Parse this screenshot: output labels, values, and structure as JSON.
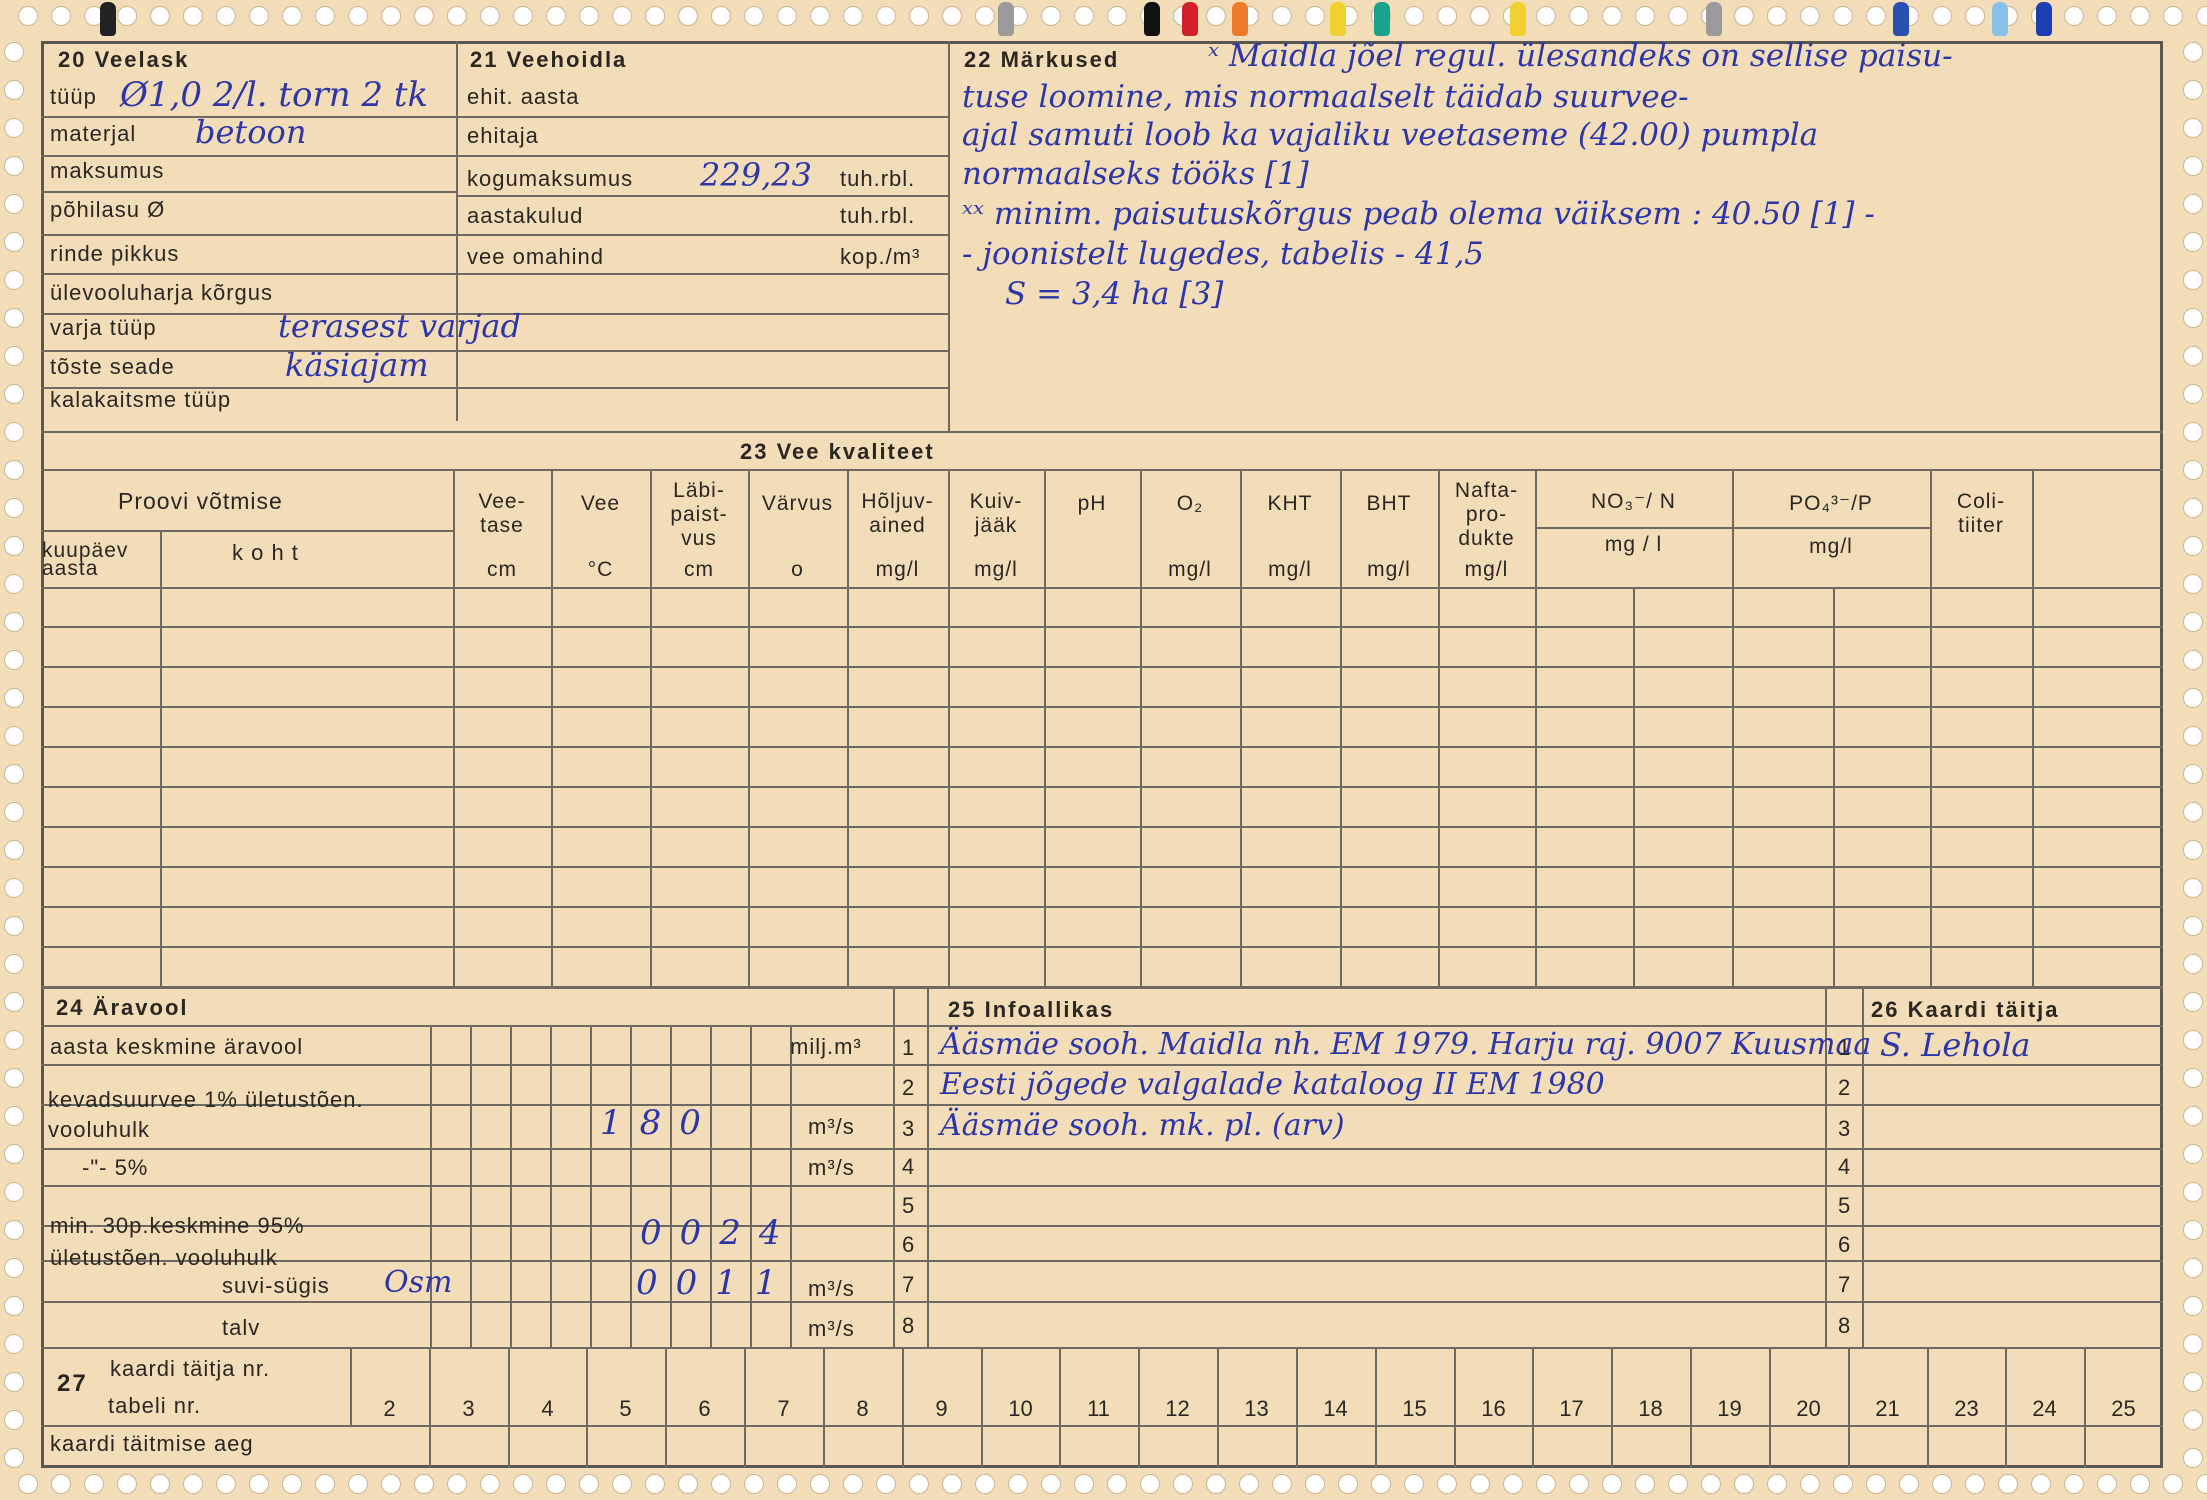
{
  "section20": {
    "title": "20 Veelask",
    "rows": [
      {
        "label": "tüüp",
        "value": "Ø1,0 2/l. torn 2 tk"
      },
      {
        "label": "materjal",
        "value": "betoon"
      },
      {
        "label": "maksumus",
        "value": ""
      },
      {
        "label": "põhilasu Ø",
        "value": ""
      },
      {
        "label": "rinde pikkus",
        "value": ""
      },
      {
        "label": "ülevooluharja kõrgus",
        "value": ""
      },
      {
        "label": "varja tüüp",
        "value": "terasest varjad"
      },
      {
        "label": "tõste seade",
        "value": "käsiajam"
      },
      {
        "label": "kalakaitsme tüüp",
        "value": ""
      }
    ]
  },
  "section21": {
    "title": "21 Veehoidla",
    "rows": [
      {
        "label": "ehit. aasta",
        "unit": "",
        "value": ""
      },
      {
        "label": "ehitaja",
        "unit": "",
        "value": ""
      },
      {
        "label": "kogumaksumus",
        "unit": "tuh.rbl.",
        "value": "229,23"
      },
      {
        "label": "aastakulud",
        "unit": "tuh.rbl.",
        "value": ""
      },
      {
        "label": "vee omahind",
        "unit": "kop./m³",
        "value": ""
      }
    ]
  },
  "section22": {
    "title": "22 Märkused",
    "lines": [
      "ˣ Maidla jõel regul. ülesandeks on sellise paisu-",
      "tuse loomine, mis normaalselt täidab suurvee-",
      "ajal samuti loob ka vajaliku veetaseme (42.00) pumpla",
      "normaalseks tööks [1]",
      "ˣˣ minim. paisutuskõrgus peab olema väiksem : 40.50 [1] -",
      "- joonistelt lugedes, tabelis - 41,5",
      "S = 3,4 ha [3]"
    ]
  },
  "section23": {
    "title": "23 Vee kvaliteet",
    "proovi": "Proovi võtmise",
    "kuupaev": "kuupäev aasta",
    "koht": "k o h t",
    "columns": [
      {
        "name": "Vee- tase",
        "unit": "cm"
      },
      {
        "name": "Vee",
        "unit": "°C"
      },
      {
        "name": "Läbi- paist- vus",
        "unit": "cm"
      },
      {
        "name": "Värvus",
        "unit": "o"
      },
      {
        "name": "Hõljuv- ained",
        "unit": "mg/l"
      },
      {
        "name": "Kuiv- jääk",
        "unit": "mg/l"
      },
      {
        "name": "pH",
        "unit": ""
      },
      {
        "name": "O₂",
        "unit": "mg/l"
      },
      {
        "name": "KHT",
        "unit": "mg/l"
      },
      {
        "name": "BHT",
        "unit": "mg/l"
      },
      {
        "name": "Nafta- pro- dukte",
        "unit": "mg/l"
      },
      {
        "name": "NO₃⁻/ N",
        "unit": "mg / l"
      },
      {
        "name": "PO₄³⁻/P",
        "unit": "mg/l"
      },
      {
        "name": "Coli- tiiter",
        "unit": ""
      }
    ]
  },
  "section24": {
    "title": "24 Äravool",
    "rows": [
      {
        "label": "aasta keskmine äravool",
        "unit": "milj.m³",
        "value": ""
      },
      {
        "label": "kevadsuurvee 1% ületustõen. vooluhulk",
        "unit": "m³/s",
        "value": "180"
      },
      {
        "label": "-\"- 5%",
        "unit": "m³/s",
        "value": ""
      },
      {
        "label": "min. 30p.keskmine 95% ületustõen. vooluhulk",
        "unit": "",
        "value": "0024"
      },
      {
        "label": "suvi-sügis",
        "unit": "m³/s",
        "value": "0011",
        "note": "Osm"
      },
      {
        "label": "talv",
        "unit": "m³/s",
        "value": ""
      }
    ]
  },
  "section25": {
    "title": "25 Infoallikas",
    "rows": [
      {
        "n": "1",
        "text": "Ääsmäe sooh. Maidla nh. EM 1979. Harju raj. 9007 Kuusmaa"
      },
      {
        "n": "2",
        "text": "Eesti jõgede valgalade kataloog II EM 1980"
      },
      {
        "n": "3",
        "text": "Ääsmäe sooh. mk. pl. (arv)"
      },
      {
        "n": "4",
        "text": ""
      },
      {
        "n": "5",
        "text": ""
      },
      {
        "n": "6",
        "text": ""
      },
      {
        "n": "7",
        "text": ""
      },
      {
        "n": "8",
        "text": ""
      }
    ]
  },
  "section26": {
    "title": "26 Kaardi täitja",
    "rows": [
      {
        "n": "1",
        "text": "S. Lehola"
      },
      {
        "n": "2",
        "text": ""
      },
      {
        "n": "3",
        "text": ""
      },
      {
        "n": "4",
        "text": ""
      },
      {
        "n": "5",
        "text": ""
      },
      {
        "n": "6",
        "text": ""
      },
      {
        "n": "7",
        "text": ""
      },
      {
        "n": "8",
        "text": ""
      }
    ]
  },
  "section27": {
    "num": "27",
    "labels": [
      "kaardi täitja nr.",
      "tabeli nr.",
      "kaardi täitmise aeg"
    ],
    "numbers": [
      "2",
      "3",
      "4",
      "5",
      "6",
      "7",
      "8",
      "9",
      "10",
      "11",
      "12",
      "13",
      "14",
      "15",
      "16",
      "17",
      "18",
      "19",
      "20",
      "21",
      "23",
      "24",
      "25"
    ]
  },
  "tab_colors": [
    "#222222",
    "#9a9a9a",
    "#111111",
    "#d0202a",
    "#ee7a2a",
    "#f0d030",
    "#18a38a",
    "#f0d030",
    "#9a9a9a",
    "#2a4fb0",
    "#88c0e8",
    "#1c3fb0"
  ]
}
